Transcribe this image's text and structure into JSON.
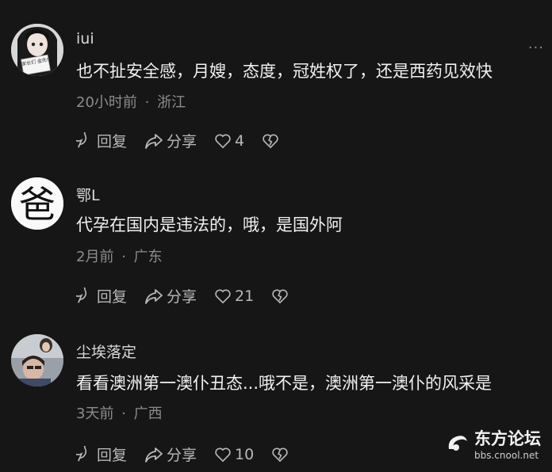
{
  "comments": [
    {
      "username": "iui",
      "content": "也不扯安全感，月嫂，态度，冠姓权了，还是西药见效快",
      "time": "20小时前",
      "separator": "·",
      "location": "浙江",
      "reply_label": "回复",
      "share_label": "分享",
      "likes": "4",
      "more": "···"
    },
    {
      "username": "鄂L",
      "content": "代孕在国内是违法的，哦，是国外阿",
      "time": "2月前",
      "separator": "·",
      "location": "广东",
      "reply_label": "回复",
      "share_label": "分享",
      "likes": "21"
    },
    {
      "username": "尘埃落定",
      "content": "看看澳洲第一澳仆丑态...哦不是，澳洲第一澳仆的风采是",
      "time": "3天前",
      "separator": "·",
      "location": "广西",
      "reply_label": "回复",
      "share_label": "分享",
      "likes": "10"
    }
  ],
  "avatar2_char": "爸",
  "avatar1_sign": "家长们 金先!",
  "watermark": {
    "name": "东方论坛",
    "url": "bbs.cnool.net"
  },
  "colors": {
    "background": "#161616",
    "text": "#f1f1f1",
    "muted": "#8c8c8c"
  }
}
